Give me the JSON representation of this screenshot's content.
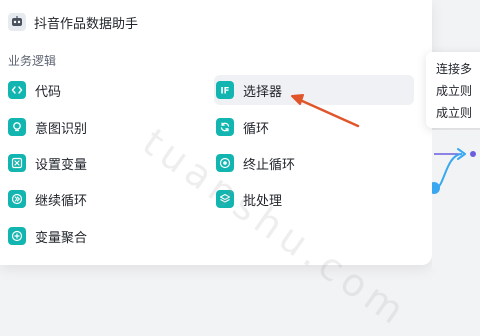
{
  "header": {
    "title": "抖音作品数据助手",
    "icon": "robot-avatar-icon"
  },
  "section": {
    "title": "业务逻辑"
  },
  "items": [
    {
      "label": "代码",
      "icon": "code-icon",
      "color": "#13b5b1"
    },
    {
      "label": "意图识别",
      "icon": "lightbulb-icon",
      "color": "#13b5b1"
    },
    {
      "label": "设置变量",
      "icon": "variable-icon",
      "color": "#13b5b1"
    },
    {
      "label": "继续循环",
      "icon": "continue-icon",
      "color": "#13b5b1"
    },
    {
      "label": "变量聚合",
      "icon": "aggregate-icon",
      "color": "#13b5b1"
    },
    {
      "label": "选择器",
      "icon": "if-icon",
      "color": "#13b5b1"
    },
    {
      "label": "循环",
      "icon": "loop-icon",
      "color": "#13b5b1"
    },
    {
      "label": "终止循环",
      "icon": "stop-loop-icon",
      "color": "#13b5b1"
    },
    {
      "label": "批处理",
      "icon": "batch-icon",
      "color": "#13b5b1"
    }
  ],
  "tooltip": {
    "lines": [
      "连接多",
      "成立则",
      "成立则"
    ]
  },
  "watermark": "tuanshu.com",
  "colors": {
    "accent": "#13b5b1",
    "arrow": "#e0562a",
    "link": "#3aa8f0",
    "node": "#6b5fe0"
  }
}
